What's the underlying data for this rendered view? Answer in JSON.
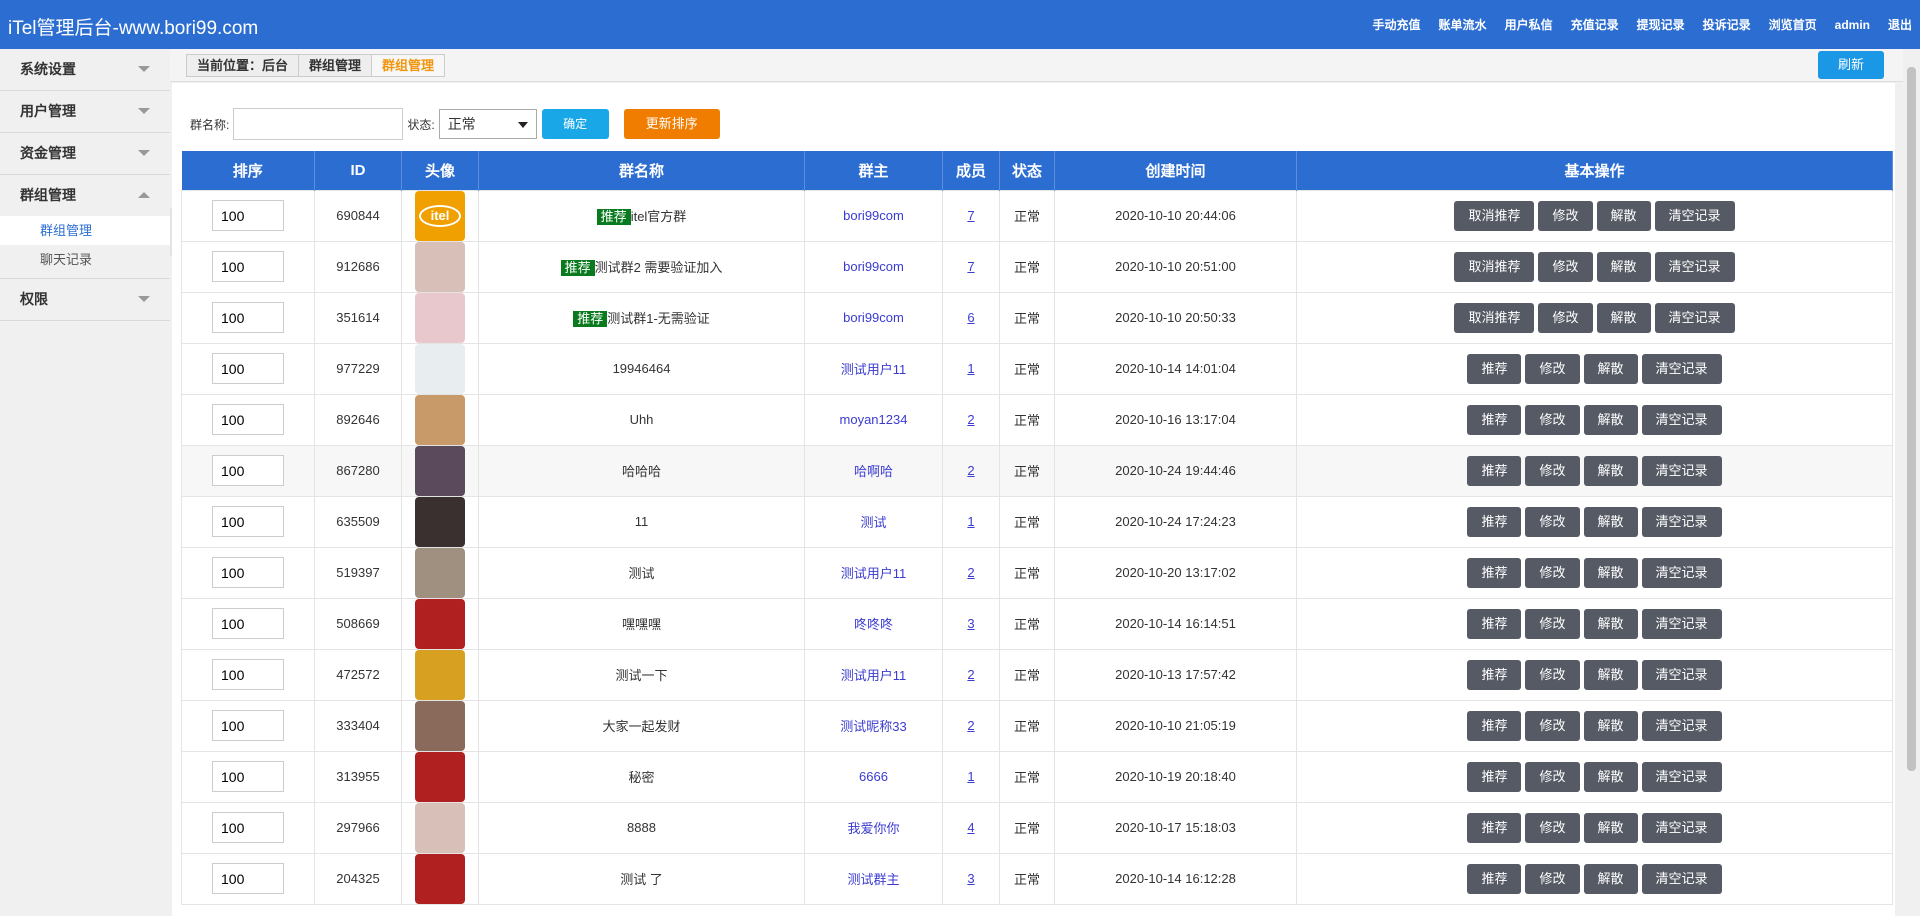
{
  "app": {
    "title": "iTel管理后台-www.bori99.com"
  },
  "topnav": [
    "手动充值",
    "账单流水",
    "用户私信",
    "充值记录",
    "提现记录",
    "投诉记录",
    "浏览首页",
    "admin",
    "退出"
  ],
  "sidebar": {
    "groups": [
      {
        "label": "系统设置",
        "expanded": false,
        "items": []
      },
      {
        "label": "用户管理",
        "expanded": false,
        "items": []
      },
      {
        "label": "资金管理",
        "expanded": false,
        "items": []
      },
      {
        "label": "群组管理",
        "expanded": true,
        "items": [
          {
            "label": "群组管理",
            "active": true
          },
          {
            "label": "聊天记录",
            "active": false
          }
        ]
      },
      {
        "label": "权限",
        "expanded": false,
        "items": []
      }
    ]
  },
  "breadcrumb": {
    "items": [
      "当前位置：后台",
      "群组管理",
      "群组管理"
    ]
  },
  "refresh_label": "刷新",
  "filter": {
    "name_label": "群名称:",
    "name_value": "",
    "status_label": "状态:",
    "status_value": "正常",
    "confirm_label": "确定",
    "sort_label": "更新排序"
  },
  "table": {
    "headers": [
      "排序",
      "ID",
      "头像",
      "群名称",
      "群主",
      "成员",
      "状态",
      "创建时间",
      "基本操作"
    ],
    "rows": [
      {
        "order": "100",
        "id": "690844",
        "avatar_color": "#f0a000",
        "avatar_text": "itel",
        "recommended": true,
        "name": "itel官方群",
        "owner": "bori99com",
        "members": "7",
        "status": "正常",
        "created": "2020-10-10 20:44:06",
        "actions": [
          "取消推荐",
          "修改",
          "解散",
          "清空记录"
        ]
      },
      {
        "order": "100",
        "id": "912686",
        "avatar_color": "#d8c0b8",
        "recommended": true,
        "name": "测试群2 需要验证加入",
        "owner": "bori99com",
        "members": "7",
        "status": "正常",
        "created": "2020-10-10 20:51:00",
        "actions": [
          "取消推荐",
          "修改",
          "解散",
          "清空记录"
        ]
      },
      {
        "order": "100",
        "id": "351614",
        "avatar_color": "#e8c8cc",
        "recommended": true,
        "name": "测试群1-无需验证",
        "owner": "bori99com",
        "members": "6",
        "status": "正常",
        "created": "2020-10-10 20:50:33",
        "actions": [
          "取消推荐",
          "修改",
          "解散",
          "清空记录"
        ]
      },
      {
        "order": "100",
        "id": "977229",
        "avatar_color": "#e8eef0",
        "recommended": false,
        "name": "19946464",
        "owner": "测试用户11",
        "members": "1",
        "status": "正常",
        "created": "2020-10-14 14:01:04",
        "actions": [
          "推荐",
          "修改",
          "解散",
          "清空记录"
        ]
      },
      {
        "order": "100",
        "id": "892646",
        "avatar_color": "#c89a6a",
        "recommended": false,
        "name": "Uhh",
        "owner": "moyan1234",
        "members": "2",
        "status": "正常",
        "created": "2020-10-16 13:17:04",
        "actions": [
          "推荐",
          "修改",
          "解散",
          "清空记录"
        ]
      },
      {
        "order": "100",
        "id": "867280",
        "avatar_color": "#5a4a5c",
        "recommended": false,
        "name": "哈哈哈",
        "owner": "哈啊哈",
        "members": "2",
        "status": "正常",
        "created": "2020-10-24 19:44:46",
        "actions": [
          "推荐",
          "修改",
          "解散",
          "清空记录"
        ]
      },
      {
        "order": "100",
        "id": "635509",
        "avatar_color": "#3a3030",
        "recommended": false,
        "name": "11",
        "owner": "测试",
        "members": "1",
        "status": "正常",
        "created": "2020-10-24 17:24:23",
        "actions": [
          "推荐",
          "修改",
          "解散",
          "清空记录"
        ]
      },
      {
        "order": "100",
        "id": "519397",
        "avatar_color": "#a09080",
        "recommended": false,
        "name": "测试",
        "owner": "测试用户11",
        "members": "2",
        "status": "正常",
        "created": "2020-10-20 13:17:02",
        "actions": [
          "推荐",
          "修改",
          "解散",
          "清空记录"
        ]
      },
      {
        "order": "100",
        "id": "508669",
        "avatar_color": "#b02020",
        "recommended": false,
        "name": "嘿嘿嘿",
        "owner": "咚咚咚",
        "members": "3",
        "status": "正常",
        "created": "2020-10-14 16:14:51",
        "actions": [
          "推荐",
          "修改",
          "解散",
          "清空记录"
        ]
      },
      {
        "order": "100",
        "id": "472572",
        "avatar_color": "#d8a020",
        "recommended": false,
        "name": "测试一下",
        "owner": "测试用户11",
        "members": "2",
        "status": "正常",
        "created": "2020-10-13 17:57:42",
        "actions": [
          "推荐",
          "修改",
          "解散",
          "清空记录"
        ]
      },
      {
        "order": "100",
        "id": "333404",
        "avatar_color": "#8a6a5a",
        "recommended": false,
        "name": "大家一起发财",
        "owner": "测试昵称33",
        "members": "2",
        "status": "正常",
        "created": "2020-10-10 21:05:19",
        "actions": [
          "推荐",
          "修改",
          "解散",
          "清空记录"
        ]
      },
      {
        "order": "100",
        "id": "313955",
        "avatar_color": "#b02020",
        "recommended": false,
        "name": "秘密",
        "owner": "6666",
        "members": "1",
        "status": "正常",
        "created": "2020-10-19 20:18:40",
        "actions": [
          "推荐",
          "修改",
          "解散",
          "清空记录"
        ]
      },
      {
        "order": "100",
        "id": "297966",
        "avatar_color": "#d8c0b8",
        "recommended": false,
        "name": "8888",
        "owner": "我爱你你",
        "members": "4",
        "status": "正常",
        "created": "2020-10-17 15:18:03",
        "actions": [
          "推荐",
          "修改",
          "解散",
          "清空记录"
        ]
      },
      {
        "order": "100",
        "id": "204325",
        "avatar_color": "#b02020",
        "recommended": false,
        "name": "测试 了",
        "owner": "测试群主",
        "members": "3",
        "status": "正常",
        "created": "2020-10-14 16:12:28",
        "actions": [
          "推荐",
          "修改",
          "解散",
          "清空记录"
        ]
      }
    ]
  },
  "colors": {
    "brand": "#2b6dd1",
    "confirm": "#19a7e8",
    "sort": "#f07c00",
    "action": "#555a64",
    "recommend_tag": "#0a7a1e"
  }
}
